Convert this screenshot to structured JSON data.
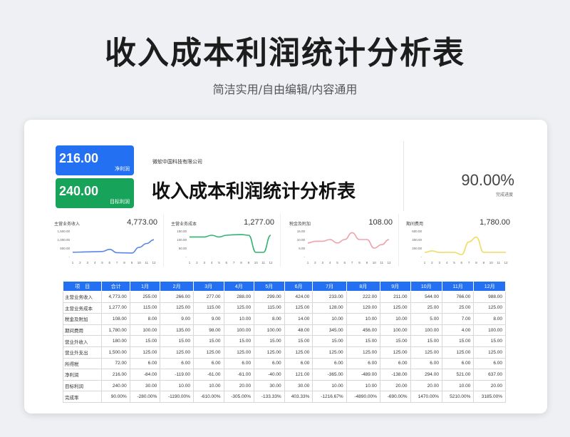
{
  "header": {
    "title": "收入成本利润统计分析表",
    "subtitle": "简洁实用/自由编辑/内容通用"
  },
  "kpis": [
    {
      "value": "216.00",
      "label": "净利润",
      "color": "#2370f2"
    },
    {
      "value": "240.00",
      "label": "目标利润",
      "color": "#17a35a"
    }
  ],
  "sheet": {
    "company": "微软中国科技有限公司",
    "title": "收入成本利润统计分析表",
    "completion_value": "90.00%",
    "completion_label": "完成进度"
  },
  "months_axis": [
    "1",
    "2",
    "3",
    "4",
    "5",
    "6",
    "7",
    "8",
    "9",
    "10",
    "11",
    "12"
  ],
  "mini_charts": [
    {
      "title": "主营业务收入",
      "value": "4,773.00",
      "color": "#5b86e5",
      "ticks": [
        "1,500.00",
        "1,000.00",
        "500.00",
        "-"
      ],
      "ymax": 1500,
      "values": [
        255,
        266,
        277,
        288,
        299,
        424,
        233,
        222,
        211,
        544,
        766,
        988
      ]
    },
    {
      "title": "主营业务成本",
      "value": "1,277.00",
      "color": "#2db46e",
      "ticks": [
        "150.00",
        "100.00",
        "50.00",
        "-"
      ],
      "ymax": 150,
      "values": [
        115,
        115,
        115,
        125,
        115,
        125,
        128,
        129,
        125,
        25,
        25,
        125
      ]
    },
    {
      "title": "税金及附加",
      "value": "108.00",
      "color": "#f0a0a8",
      "ticks": [
        "15.00",
        "10.00",
        "5.00",
        "-"
      ],
      "ymax": 15,
      "values": [
        8,
        9,
        9,
        10,
        8,
        10,
        14,
        10,
        10,
        5,
        7,
        10
      ]
    },
    {
      "title": "期间费用",
      "value": "1,780.00",
      "color": "#f1dc62",
      "ticks": [
        "600.00",
        "400.00",
        "200.00",
        "-"
      ],
      "ymax": 600,
      "values": [
        100,
        135,
        98,
        100,
        100,
        48,
        345,
        456,
        100,
        100,
        100,
        100
      ]
    }
  ],
  "table": {
    "headers": [
      "项　目",
      "合计",
      "1月",
      "2月",
      "3月",
      "4月",
      "5月",
      "6月",
      "7月",
      "8月",
      "9月",
      "10月",
      "11月",
      "12月"
    ],
    "rows": [
      [
        "主营业务收入",
        "4,773.00",
        "255.00",
        "266.00",
        "277.00",
        "288.00",
        "299.00",
        "424.00",
        "233.00",
        "222.00",
        "211.00",
        "544.00",
        "766.00",
        "988.00"
      ],
      [
        "主营业务成本",
        "1,277.00",
        "115.00",
        "125.00",
        "115.00",
        "125.00",
        "115.00",
        "125.00",
        "128.00",
        "129.00",
        "125.00",
        "25.00",
        "25.00",
        "125.00"
      ],
      [
        "税金及附加",
        "108.00",
        "8.00",
        "9.00",
        "9.00",
        "10.00",
        "8.00",
        "14.00",
        "10.00",
        "10.00",
        "10.00",
        "5.00",
        "7.00",
        "8.00"
      ],
      [
        "期间费用",
        "1,780.00",
        "100.00",
        "135.00",
        "98.00",
        "100.00",
        "100.00",
        "48.00",
        "345.00",
        "456.00",
        "100.00",
        "100.00",
        "4.00",
        "100.00"
      ],
      [
        "营业外收入",
        "180.00",
        "15.00",
        "15.00",
        "15.00",
        "15.00",
        "15.00",
        "15.00",
        "15.00",
        "15.00",
        "15.00",
        "15.00",
        "15.00",
        "15.00"
      ],
      [
        "营业外支出",
        "1,500.00",
        "125.00",
        "125.00",
        "125.00",
        "125.00",
        "125.00",
        "125.00",
        "125.00",
        "125.00",
        "125.00",
        "125.00",
        "125.00",
        "125.00"
      ],
      [
        "所得税",
        "72.00",
        "6.00",
        "6.00",
        "6.00",
        "6.00",
        "6.00",
        "6.00",
        "6.00",
        "6.00",
        "6.00",
        "6.00",
        "6.00",
        "6.00"
      ],
      [
        "净利润",
        "216.00",
        "-84.00",
        "-119.00",
        "-61.00",
        "-61.00",
        "-40.00",
        "121.00",
        "-365.00",
        "-489.00",
        "-138.00",
        "294.00",
        "521.00",
        "637.00"
      ],
      [
        "目标利润",
        "240.00",
        "30.00",
        "10.00",
        "10.00",
        "20.00",
        "30.00",
        "30.00",
        "10.00",
        "10.00",
        "20.00",
        "20.00",
        "10.00",
        "20.00"
      ],
      [
        "完成率",
        "90.00%",
        "-280.00%",
        "-1190.00%",
        "-610.00%",
        "-305.00%",
        "-133.33%",
        "403.33%",
        "-1216.67%",
        "-4890.00%",
        "-690.00%",
        "1470.00%",
        "5210.00%",
        "3185.00%"
      ]
    ]
  }
}
